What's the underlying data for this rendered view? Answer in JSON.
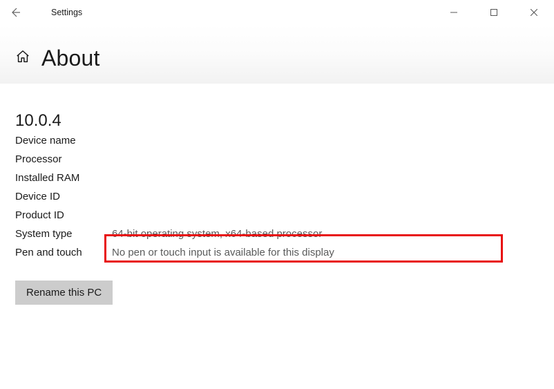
{
  "titlebar": {
    "app_title": "Settings"
  },
  "header": {
    "page_title": "About"
  },
  "about": {
    "version": "10.0.4",
    "specs": {
      "device_name_label": "Device name",
      "device_name_value": "",
      "processor_label": "Processor",
      "processor_value": "",
      "installed_ram_label": "Installed RAM",
      "installed_ram_value": "",
      "device_id_label": "Device ID",
      "device_id_value": "",
      "product_id_label": "Product ID",
      "product_id_value": "",
      "system_type_label": "System type",
      "system_type_value": "64-bit operating system, x64-based processor",
      "pen_touch_label": "Pen and touch",
      "pen_touch_value": "No pen or touch input is available for this display"
    },
    "rename_button": "Rename this PC"
  }
}
